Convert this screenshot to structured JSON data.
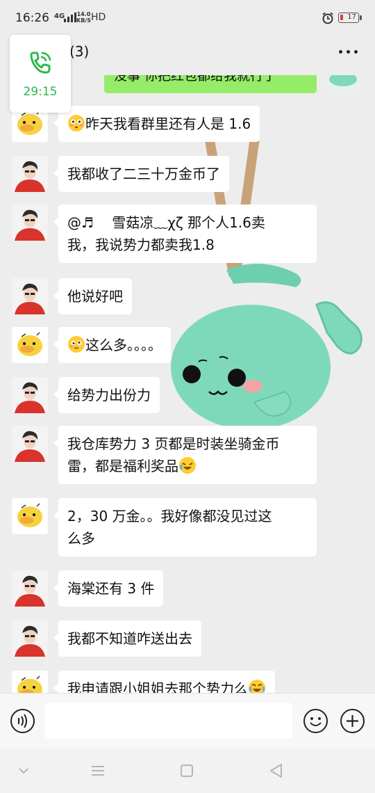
{
  "status_bar": {
    "time": "16:26",
    "network": "4G",
    "speed_value": "14.0",
    "speed_unit": "KB/S",
    "hd": "HD",
    "battery": "17",
    "icons": [
      "signal-icon",
      "alarm-icon",
      "battery-icon"
    ]
  },
  "header": {
    "title": "(3)",
    "more_icon": "more-icon"
  },
  "call": {
    "timer": "29:15",
    "icon": "phone-icon",
    "color": "#2db84d"
  },
  "top_message": {
    "text": "没事 你把红包都给我就行了"
  },
  "messages": [
    {
      "text": "昨天我看群里还有人是 1.6",
      "avatar": "duck"
    },
    {
      "text": "我都收了二三十万金币了",
      "avatar": "man"
    },
    {
      "line1": "@♬　  雪菇凉﹏χζ 那个人1.6卖",
      "line2": "我，我说势力都卖我1.8",
      "avatar": "man"
    },
    {
      "text": "他说好吧",
      "avatar": "man"
    },
    {
      "text": "这么多。。。。",
      "avatar": "duck"
    },
    {
      "text": "给势力出份力",
      "avatar": "man"
    },
    {
      "line1": "我仓库势力 3 页都是时装坐骑金币",
      "line2": "雷，都是福利奖品",
      "avatar": "man"
    },
    {
      "line1": "2，30 万金。。我好像都没见过这",
      "line2": "么多",
      "avatar": "duck"
    },
    {
      "text": "海棠还有 3 件",
      "avatar": "man"
    },
    {
      "text": "我都不知道咋送出去",
      "avatar": "man"
    },
    {
      "text": "我申请跟小姐姐去那个势力么",
      "avatar": "duck"
    }
  ],
  "input": {
    "value": "",
    "placeholder": ""
  },
  "colors": {
    "background": "#ededed",
    "bubble_self": "#95ec69",
    "bubble_other": "#ffffff"
  }
}
